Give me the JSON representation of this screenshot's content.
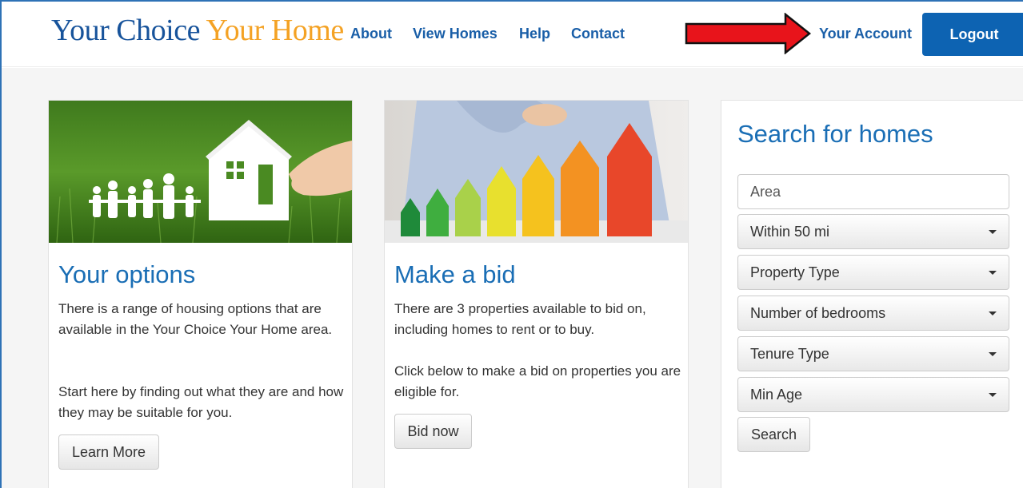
{
  "header": {
    "logo_part1": "Your Choice",
    "logo_part2": "Your Home",
    "nav": [
      {
        "label": "About"
      },
      {
        "label": "View Homes"
      },
      {
        "label": "Help"
      },
      {
        "label": "Contact"
      }
    ],
    "account_label": "Your Account",
    "logout_label": "Logout",
    "colors": {
      "brand_blue": "#17539b",
      "brand_orange": "#f4a224",
      "logout_bg": "#0d63b2",
      "annotation_arrow": "#e8141b"
    }
  },
  "cards": [
    {
      "image_icon": "family-house-on-grass-image",
      "title": "Your options",
      "para1": "There is a range of housing options that are available in the Your Choice Your Home area.",
      "para2": "Start here by finding out what they are and how they may be suitable for you.",
      "button": "Learn More"
    },
    {
      "image_icon": "energy-rating-houses-image",
      "title": "Make a bid",
      "para1": "There are 3 properties available to bid on, including homes to rent or to buy.",
      "para2": "Click below to make a bid on properties you are eligible for.",
      "button": "Bid now"
    }
  ],
  "search": {
    "title": "Search for homes",
    "area_placeholder": "Area",
    "selects": [
      {
        "label": "Within 50 mi"
      },
      {
        "label": "Property Type"
      },
      {
        "label": "Number of bedrooms"
      },
      {
        "label": "Tenure Type"
      },
      {
        "label": "Min Age"
      }
    ],
    "button": "Search"
  }
}
